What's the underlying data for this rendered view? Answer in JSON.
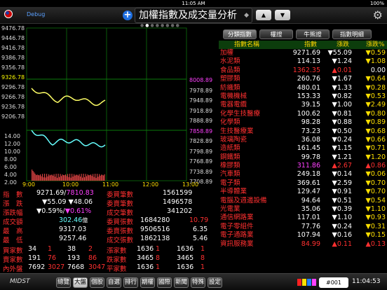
{
  "status": {
    "time": "11:05 AM",
    "battery": "100%"
  },
  "header": {
    "debug": "Debug",
    "title": "加權指數及成交量分析",
    "spinner": "◆",
    "up_arrow": "▲",
    "down_arrow": "▼",
    "settings_icon": "gear-icon"
  },
  "chart": {
    "left_ticks": [
      "9476.78",
      "9446.78",
      "9416.78",
      "9386.78",
      "9356.78",
      "9326.78",
      "9296.78",
      "9266.78",
      "9236.78",
      "9206.78"
    ],
    "left_ticks2": [
      "14.00",
      "12.00",
      "10.00",
      "8.00",
      "6.00",
      "4.00",
      "2.00"
    ],
    "right_ticks": [
      "8008.89",
      "7978.89",
      "7948.89",
      "7918.89",
      "7888.89",
      "7858.89",
      "7828.89",
      "7798.89",
      "7768.89",
      "7738.89",
      "7708.89"
    ],
    "time_ticks": [
      "9:00",
      "10:00",
      "11:00",
      "12:00",
      "13:00"
    ]
  },
  "summary": {
    "index_label": "指　數",
    "index_value": "9271.69",
    "index_slash": "/",
    "index_otc": "7810.83",
    "chg_label": "漲　跌",
    "chg_value": "▼55.09",
    "chg_otc": "▼48.06",
    "pct_label": "漲跌幅",
    "pct_value": "▼0.59%",
    "pct_otc": "▼0.61%",
    "amt_label": "成交額",
    "amt_value": "302.46",
    "amt_unit": "億",
    "high_label": "最　高",
    "high_value": "9317.03",
    "low_label": "最　低",
    "low_value": "9257.46",
    "bid_count_label": "委買筆數",
    "bid_count": "1561599",
    "ask_count_label": "委賣筆數",
    "ask_count": "1496578",
    "deal_count_label": "成交筆數",
    "deal_count": "341202",
    "bid_lots_label": "委買張數",
    "bid_lots": "1684280",
    "bid_ratio": "10.79",
    "ask_lots_label": "委賣張數",
    "ask_lots": "9506516",
    "ask_ratio": "6.35",
    "deal_lots_label": "成交張數",
    "deal_lots": "1862138",
    "deal_ratio": "5.46",
    "buy_label": "買家數",
    "buy_a": "34",
    "buy_b": "1",
    "buy_c": "38",
    "buy_d": "2",
    "sell_label": "賣家數",
    "sell_a": "191",
    "sell_b": "76",
    "sell_c": "193",
    "sell_d": "86",
    "out_label": "內外盤",
    "out_a": "7692",
    "out_b": "3027",
    "out_c": "7668",
    "out_d": "3047",
    "up_label": "漲家數",
    "up_a": "1636",
    "up_b": "1",
    "up_c": "1636",
    "up_d": "1",
    "down_label": "跌家數",
    "down_a": "3465",
    "down_b": "8",
    "down_c": "3465",
    "down_d": "8",
    "flat_label": "平家數",
    "flat_a": "1636",
    "flat_b": "1",
    "flat_c": "1636",
    "flat_d": "1"
  },
  "table": {
    "tabs": [
      "分類指數",
      "權證",
      "牛熊證",
      "指數明細"
    ],
    "headers": {
      "name": "指數名稱",
      "price": "指數",
      "chg": "漲跌",
      "pct": "漲跌%"
    },
    "rows": [
      {
        "name": "加權",
        "price": "9271.69",
        "chg": "▼55.09",
        "pct": "▼0.59",
        "pc": "dn",
        "cc": "dn",
        "nc": "up"
      },
      {
        "name": "水泥類",
        "price": "114.13",
        "chg": "▼1.24",
        "pct": "▼1.08",
        "pc": "dn",
        "cc": "dn",
        "nc": "up"
      },
      {
        "name": "食品類",
        "price": "1362.35",
        "chg": "▲0.01",
        "pct": "0.00",
        "pc": "up",
        "cc": "up",
        "nc": "up"
      },
      {
        "name": "塑膠類",
        "price": "260.76",
        "chg": "▼1.67",
        "pct": "▼0.64",
        "pc": "dn",
        "cc": "dn",
        "nc": "up"
      },
      {
        "name": "紡織類",
        "price": "480.01",
        "chg": "▼1.33",
        "pct": "▼0.28",
        "pc": "dn",
        "cc": "dn",
        "nc": "up"
      },
      {
        "name": "電機機械",
        "price": "153.33",
        "chg": "▼0.82",
        "pct": "▼0.53",
        "pc": "dn",
        "cc": "dn",
        "nc": "up"
      },
      {
        "name": "電器電纜",
        "price": "39.15",
        "chg": "▼1.00",
        "pct": "▼2.49",
        "pc": "dn",
        "cc": "dn",
        "nc": "up"
      },
      {
        "name": "化學生技醫療",
        "price": "100.62",
        "chg": "▼0.81",
        "pct": "▼0.80",
        "pc": "dn",
        "cc": "dn",
        "nc": "up"
      },
      {
        "name": "化學類",
        "price": "98.28",
        "chg": "▼0.88",
        "pct": "▼0.89",
        "pc": "dn",
        "cc": "dn",
        "nc": "up"
      },
      {
        "name": "生技醫療業",
        "price": "73.23",
        "chg": "▼0.50",
        "pct": "▼0.68",
        "pc": "dn",
        "cc": "dn",
        "nc": "up"
      },
      {
        "name": "玻璃陶瓷",
        "price": "36.08",
        "chg": "▼0.24",
        "pct": "▼0.66",
        "pc": "dn",
        "cc": "dn",
        "nc": "up"
      },
      {
        "name": "造紙類",
        "price": "161.45",
        "chg": "▼1.15",
        "pct": "▼0.71",
        "pc": "dn",
        "cc": "dn",
        "nc": "up"
      },
      {
        "name": "鋼鐵類",
        "price": "99.78",
        "chg": "▼1.21",
        "pct": "▼1.20",
        "pc": "dn",
        "cc": "dn",
        "nc": "up"
      },
      {
        "name": "橡膠類",
        "price": "311.86",
        "chg": "▲2.67",
        "pct": "▲0.86",
        "pc": "mg",
        "cc": "up",
        "nc": "up"
      },
      {
        "name": "汽車類",
        "price": "249.18",
        "chg": "▼0.14",
        "pct": "▼0.06",
        "pc": "dn",
        "cc": "dn",
        "nc": "up"
      },
      {
        "name": "電子類",
        "price": "369.61",
        "chg": "▼2.59",
        "pct": "▼0.70",
        "pc": "dn",
        "cc": "dn",
        "nc": "up"
      },
      {
        "name": "半導體業",
        "price": "129.47",
        "chg": "▼0.91",
        "pct": "▼0.70",
        "pc": "dn",
        "cc": "dn",
        "nc": "up"
      },
      {
        "name": "電腦及週邊設備",
        "price": "94.64",
        "chg": "▼0.51",
        "pct": "▼0.54",
        "pc": "dn",
        "cc": "dn",
        "nc": "up"
      },
      {
        "name": "光電業",
        "price": "35.06",
        "chg": "▼0.39",
        "pct": "▼1.10",
        "pc": "dn",
        "cc": "dn",
        "nc": "up"
      },
      {
        "name": "通信網路業",
        "price": "117.01",
        "chg": "▼1.10",
        "pct": "▼0.93",
        "pc": "dn",
        "cc": "dn",
        "nc": "up"
      },
      {
        "name": "電子零組件",
        "price": "77.76",
        "chg": "▼0.24",
        "pct": "▼0.31",
        "pc": "dn",
        "cc": "dn",
        "nc": "up"
      },
      {
        "name": "電子通路業",
        "price": "107.94",
        "chg": "▼0.16",
        "pct": "▼0.15",
        "pc": "dn",
        "cc": "dn",
        "nc": "up"
      },
      {
        "name": "資訊服務業",
        "price": "84.99",
        "chg": "▲0.11",
        "pct": "▲0.13",
        "pc": "up",
        "cc": "up",
        "nc": "up"
      }
    ]
  },
  "bottom": {
    "logo": "MIDST",
    "buttons": [
      "總覽",
      "大盤",
      "個股",
      "自選",
      "排行",
      "期權",
      "國際",
      "新聞",
      "特殊",
      "設定"
    ],
    "code": "#001",
    "clock": "11:04:53"
  },
  "colors": {
    "up": "#ff3030",
    "down": "#ffffff",
    "accent": "#1f6fe0",
    "header_bg": "#0c3d0c"
  }
}
